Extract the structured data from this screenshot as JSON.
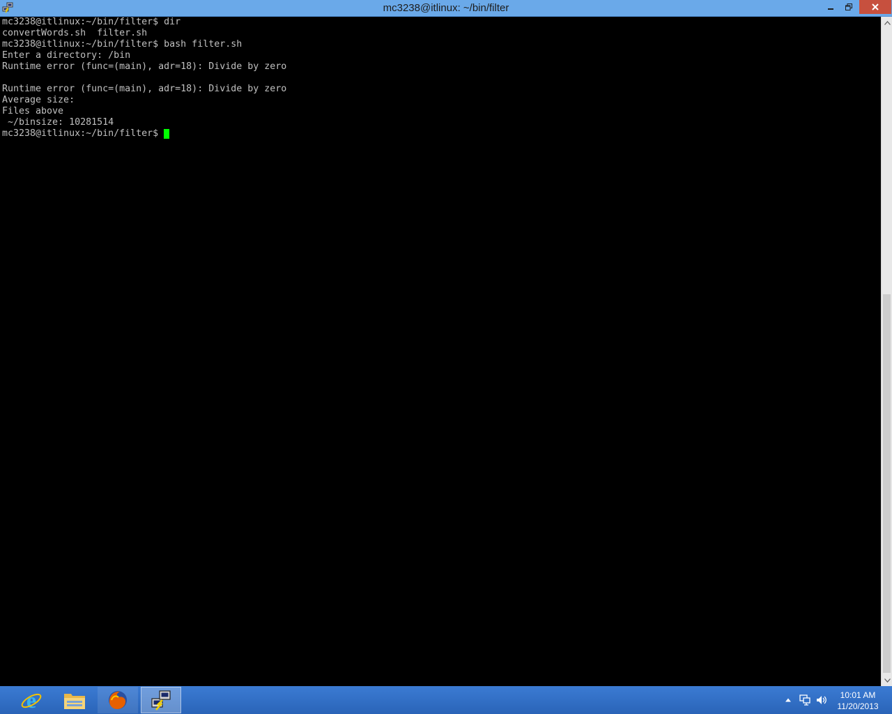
{
  "window": {
    "title": "mc3238@itlinux: ~/bin/filter",
    "app_icon": "putty-icon",
    "controls": [
      "minimize-icon",
      "restore-icon",
      "close-icon"
    ]
  },
  "terminal": {
    "lines": [
      "mc3238@itlinux:~/bin/filter$ dir",
      "convertWords.sh  filter.sh",
      "mc3238@itlinux:~/bin/filter$ bash filter.sh",
      "Enter a directory: /bin",
      "Runtime error (func=(main), adr=18): Divide by zero",
      "",
      "Runtime error (func=(main), adr=18): Divide by zero",
      "Average size:",
      "Files above",
      " ~/binsize: 10281514",
      "mc3238@itlinux:~/bin/filter$ "
    ],
    "colors": {
      "background": "#000000",
      "text": "#c0c0c0",
      "cursor": "#00ff00"
    }
  },
  "taskbar": {
    "apps": [
      {
        "name": "Internet Explorer",
        "icon": "internet-explorer-icon"
      },
      {
        "name": "File Explorer",
        "icon": "file-explorer-icon"
      },
      {
        "name": "Firefox",
        "icon": "firefox-icon"
      },
      {
        "name": "PuTTY",
        "icon": "putty-icon",
        "active": true
      }
    ],
    "tray_icons": [
      "show-hidden-icons-icon",
      "network-icon",
      "volume-icon"
    ],
    "clock": {
      "time": "10:01 AM",
      "date": "11/20/2013"
    },
    "colors": {
      "background": "#2f6fc7"
    }
  }
}
